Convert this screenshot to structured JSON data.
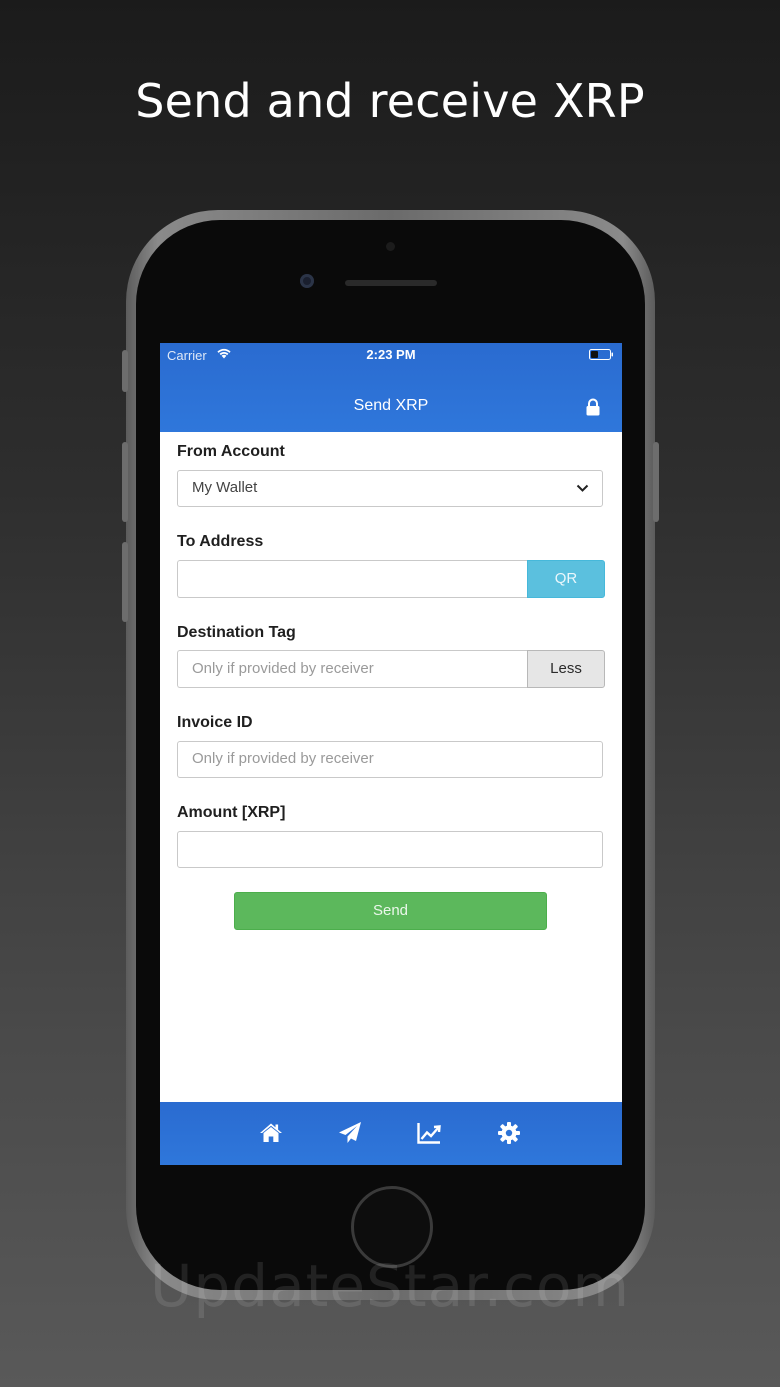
{
  "headline": "Send and receive XRP",
  "status_bar": {
    "carrier": "Carrier",
    "time": "2:23 PM"
  },
  "header": {
    "title": "Send XRP"
  },
  "form": {
    "from_account": {
      "label": "From Account",
      "value": "My Wallet"
    },
    "to_address": {
      "label": "To Address",
      "value": "",
      "button": "QR"
    },
    "destination_tag": {
      "label": "Destination Tag",
      "placeholder": "Only if provided by receiver",
      "button": "Less"
    },
    "invoice_id": {
      "label": "Invoice ID",
      "placeholder": "Only if provided by receiver"
    },
    "amount": {
      "label": "Amount [XRP]",
      "value": ""
    },
    "send_label": "Send"
  },
  "tabbar": {
    "items": [
      {
        "icon": "home-icon"
      },
      {
        "icon": "paper-plane-icon"
      },
      {
        "icon": "chart-line-icon"
      },
      {
        "icon": "gear-icon"
      }
    ]
  },
  "watermark": "UpdateStar.com",
  "colors": {
    "header_blue": "#2f77db",
    "qr_button": "#5bc0de",
    "send_button": "#5cb85c",
    "less_button": "#e6e6e6"
  }
}
